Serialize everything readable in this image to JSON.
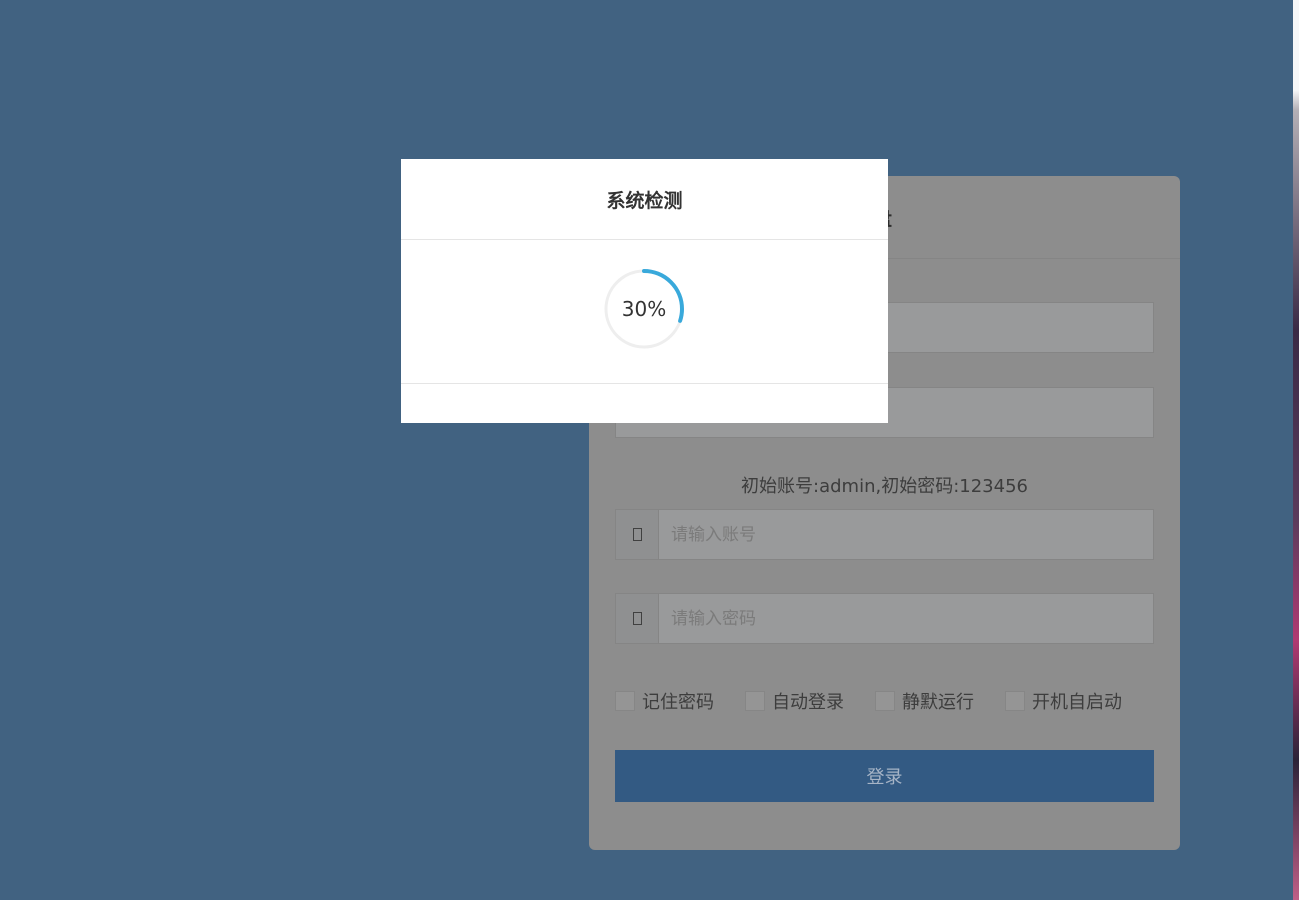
{
  "login_card": {
    "title_visible": "盘",
    "hint": "初始账号:admin,初始密码:123456",
    "account_placeholder": "请输入账号",
    "password_placeholder": "请输入密码",
    "checkboxes": [
      {
        "label": "记住密码"
      },
      {
        "label": "自动登录"
      },
      {
        "label": "静默运行"
      },
      {
        "label": "开机自启动"
      }
    ],
    "login_button": "登录"
  },
  "modal": {
    "title": "系统检测",
    "progress_text": "30%",
    "progress_value": 0.3,
    "progress_color": "#39a9db",
    "track_color": "#eeeeee"
  },
  "colors": {
    "backdrop": "#416281",
    "card_dimmed": "#8d8d8d",
    "button": "#335a83"
  }
}
